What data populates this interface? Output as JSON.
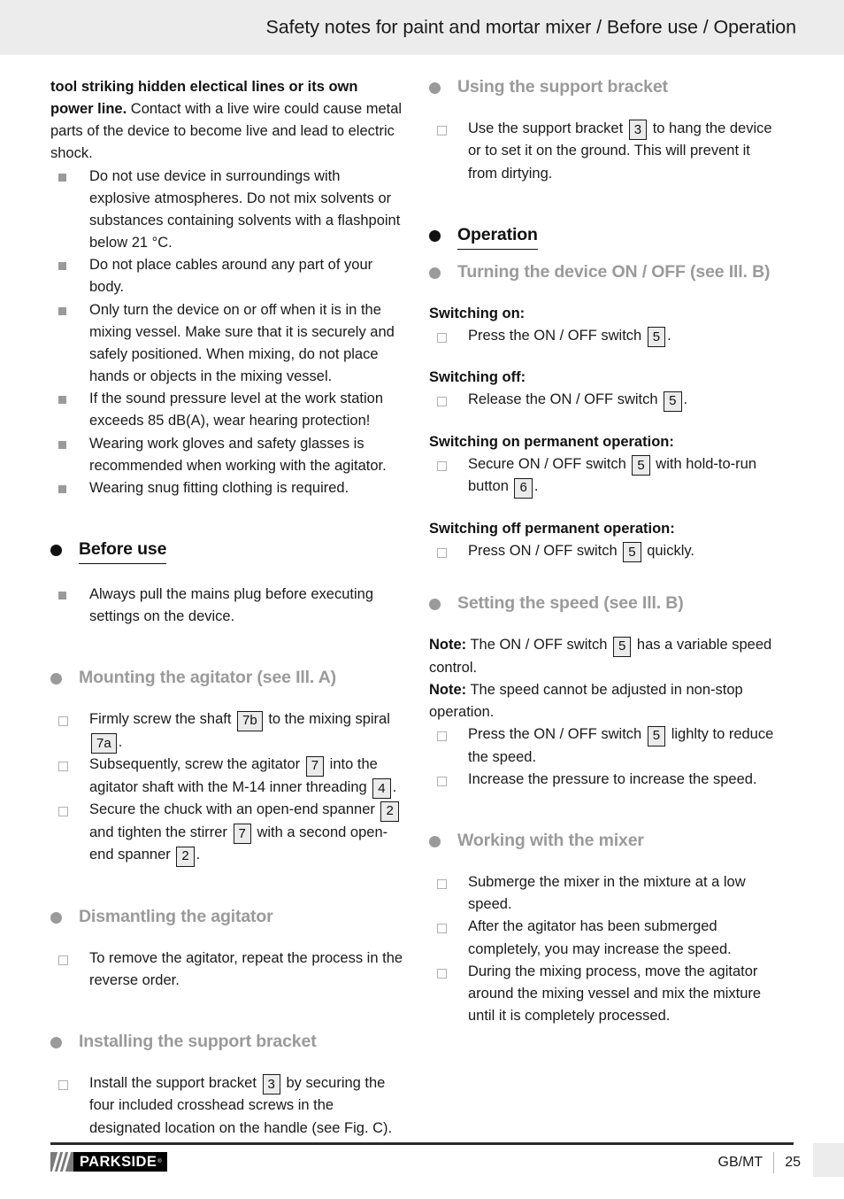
{
  "header": {
    "title": "Safety notes for paint and mortar mixer / Before use / Operation"
  },
  "left_column": {
    "safety_intro": {
      "bold_lead": "tool striking hidden electical lines or its own power line.",
      "rest": " Contact with a live wire could cause metal parts of the device to become live and lead to electric shock."
    },
    "safety_bullets": [
      "Do not use device in surroundings with explosive atmospheres. Do not mix solvents or substances containing solvents with a flashpoint below 21 °C.",
      "Do not place cables around any part of your body.",
      "Only turn the device on or off when it is in the mixing vessel. Make sure that it is securely and safely positioned. When mixing, do not place hands or objects in the mixing vessel.",
      "If the sound pressure level at the work station exceeds 85 dB(A), wear hearing protection!",
      "Wearing work gloves and safety glasses is recommended when working with the agitator.",
      "Wearing snug fitting clothing is required."
    ],
    "before_use": {
      "heading": "Before use",
      "bullets": [
        "Always pull the mains plug before executing settings on the device."
      ]
    },
    "mounting": {
      "heading": "Mounting the agitator (see Ill. A)",
      "items": [
        {
          "parts": [
            {
              "t": "text",
              "v": "Firmly screw the shaft "
            },
            {
              "t": "ref",
              "v": "7b"
            },
            {
              "t": "text",
              "v": " to the mixing spiral "
            },
            {
              "t": "ref",
              "v": "7a"
            },
            {
              "t": "text",
              "v": "."
            }
          ]
        },
        {
          "parts": [
            {
              "t": "text",
              "v": "Subsequently, screw the agitator "
            },
            {
              "t": "ref",
              "v": "7"
            },
            {
              "t": "text",
              "v": " into the agitator shaft with the M-14 inner threading "
            },
            {
              "t": "ref",
              "v": "4"
            },
            {
              "t": "text",
              "v": "."
            }
          ]
        },
        {
          "parts": [
            {
              "t": "text",
              "v": "Secure the chuck with an open-end spanner "
            },
            {
              "t": "ref",
              "v": "2"
            },
            {
              "t": "text",
              "v": " and tighten the stirrer "
            },
            {
              "t": "ref",
              "v": "7"
            },
            {
              "t": "text",
              "v": " with a second open-end spanner "
            },
            {
              "t": "ref",
              "v": "2"
            },
            {
              "t": "text",
              "v": "."
            }
          ]
        }
      ]
    },
    "dismantling": {
      "heading": "Dismantling the agitator",
      "items": [
        {
          "parts": [
            {
              "t": "text",
              "v": "To remove the agitator, repeat the process in the reverse order."
            }
          ]
        }
      ]
    },
    "installing": {
      "heading": "Installing the support bracket",
      "items": [
        {
          "parts": [
            {
              "t": "text",
              "v": "Install the support bracket "
            },
            {
              "t": "ref",
              "v": "3"
            },
            {
              "t": "text",
              "v": " by securing the four included crosshead screws in the designated location on the handle (see Fig. C)."
            }
          ]
        }
      ]
    }
  },
  "right_column": {
    "using_bracket": {
      "heading": "Using the support bracket",
      "items": [
        {
          "parts": [
            {
              "t": "text",
              "v": "Use the support bracket "
            },
            {
              "t": "ref",
              "v": "3"
            },
            {
              "t": "text",
              "v": " to hang the device or to set it on the ground. This will prevent it from dirtying."
            }
          ]
        }
      ]
    },
    "operation": {
      "heading": "Operation"
    },
    "turning_on_off": {
      "heading": "Turning the device ON / OFF (see Ill. B)",
      "groups": [
        {
          "label": "Switching on:",
          "items": [
            {
              "parts": [
                {
                  "t": "text",
                  "v": "Press the ON / OFF switch "
                },
                {
                  "t": "ref",
                  "v": "5"
                },
                {
                  "t": "text",
                  "v": "."
                }
              ]
            }
          ]
        },
        {
          "label": "Switching off:",
          "items": [
            {
              "parts": [
                {
                  "t": "text",
                  "v": "Release the ON / OFF switch "
                },
                {
                  "t": "ref",
                  "v": "5"
                },
                {
                  "t": "text",
                  "v": "."
                }
              ]
            }
          ]
        },
        {
          "label": "Switching on permanent operation:",
          "items": [
            {
              "parts": [
                {
                  "t": "text",
                  "v": "Secure ON / OFF switch "
                },
                {
                  "t": "ref",
                  "v": "5"
                },
                {
                  "t": "text",
                  "v": " with hold-to-run button "
                },
                {
                  "t": "ref",
                  "v": "6"
                },
                {
                  "t": "text",
                  "v": "."
                }
              ]
            }
          ]
        },
        {
          "label": "Switching off permanent operation:",
          "items": [
            {
              "parts": [
                {
                  "t": "text",
                  "v": "Press ON / OFF switch "
                },
                {
                  "t": "ref",
                  "v": "5"
                },
                {
                  "t": "text",
                  "v": " quickly."
                }
              ]
            }
          ]
        }
      ]
    },
    "setting_speed": {
      "heading": "Setting the speed (see Ill. B)",
      "notes": [
        {
          "parts": [
            {
              "t": "bold",
              "v": "Note:"
            },
            {
              "t": "text",
              "v": " The ON / OFF switch "
            },
            {
              "t": "ref",
              "v": "5"
            },
            {
              "t": "text",
              "v": " has a variable speed control."
            }
          ]
        },
        {
          "parts": [
            {
              "t": "bold",
              "v": "Note:"
            },
            {
              "t": "text",
              "v": " The speed cannot be adjusted in non-stop operation."
            }
          ]
        }
      ],
      "items": [
        {
          "parts": [
            {
              "t": "text",
              "v": "Press the ON / OFF switch "
            },
            {
              "t": "ref",
              "v": "5"
            },
            {
              "t": "text",
              "v": " lighlty to reduce the speed."
            }
          ]
        },
        {
          "parts": [
            {
              "t": "text",
              "v": "Increase the pressure to increase the speed."
            }
          ]
        }
      ]
    },
    "working_with_mixer": {
      "heading": "Working with the mixer",
      "items": [
        {
          "parts": [
            {
              "t": "text",
              "v": "Submerge the mixer in the mixture at a low speed."
            }
          ]
        },
        {
          "parts": [
            {
              "t": "text",
              "v": "After the agitator has been submerged completely, you may increase the speed."
            }
          ]
        },
        {
          "parts": [
            {
              "t": "text",
              "v": "During the mixing process, move the agitator around the mixing vessel and mix the mixture until it is completely processed."
            }
          ]
        }
      ]
    }
  },
  "footer": {
    "brand": "PARKSIDE",
    "brand_mark": "®",
    "language": "GB/MT",
    "page_number": "25"
  }
}
